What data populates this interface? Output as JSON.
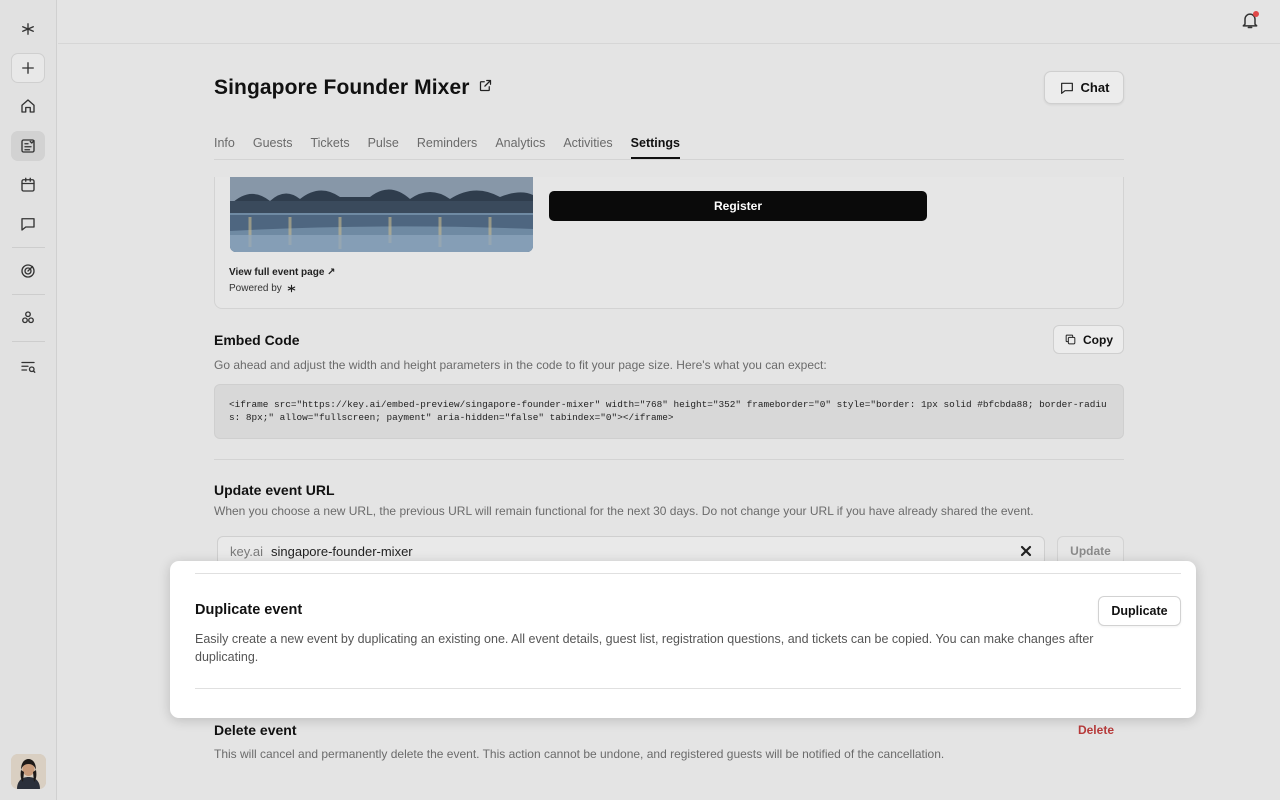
{
  "sidebar": {
    "items": [
      {
        "name": "logo"
      },
      {
        "name": "new"
      },
      {
        "name": "home"
      },
      {
        "name": "events"
      },
      {
        "name": "calendar"
      },
      {
        "name": "chat"
      },
      {
        "name": "insights"
      },
      {
        "name": "integrations"
      },
      {
        "name": "search-list"
      }
    ]
  },
  "event": {
    "title": "Singapore Founder Mixer",
    "chat_label": "Chat"
  },
  "tabs": [
    "Info",
    "Guests",
    "Tickets",
    "Pulse",
    "Reminders",
    "Analytics",
    "Activities",
    "Settings"
  ],
  "active_tab": "Settings",
  "preview": {
    "register_label": "Register",
    "full_page_link": "View full event page ↗",
    "powered_by": "Powered by"
  },
  "embed": {
    "title": "Embed Code",
    "copy_label": "Copy",
    "description": "Go ahead and adjust the width and height parameters in the code to fit your page size. Here's what you can expect:",
    "code": "<iframe src=\"https://key.ai/embed-preview/singapore-founder-mixer\" width=\"768\" height=\"352\" frameborder=\"0\" style=\"border: 1px solid #bfcbda88; border-radius: 8px;\" allow=\"fullscreen; payment\" aria-hidden=\"false\" tabindex=\"0\"></iframe>"
  },
  "url": {
    "title": "Update event URL",
    "description": "When you choose a new URL, the previous URL will remain functional for the next 30 days. Do not change your URL if you have already shared the event.",
    "prefix": "key.ai",
    "value": "singapore-founder-mixer",
    "update_label": "Update"
  },
  "duplicate": {
    "title": "Duplicate event",
    "button_label": "Duplicate",
    "description": "Easily create a new event by duplicating an existing one. All event details, guest list, registration questions, and tickets can be copied. You can make changes after duplicating."
  },
  "delete": {
    "title": "Delete event",
    "button_label": "Delete",
    "description": "This will cancel and permanently delete the event. This action cannot be undone, and registered guests will be notified of the cancellation."
  },
  "colors": {
    "accent": "#0a0a0a",
    "danger": "#b73a3a",
    "notification_dot": "#e04848"
  }
}
